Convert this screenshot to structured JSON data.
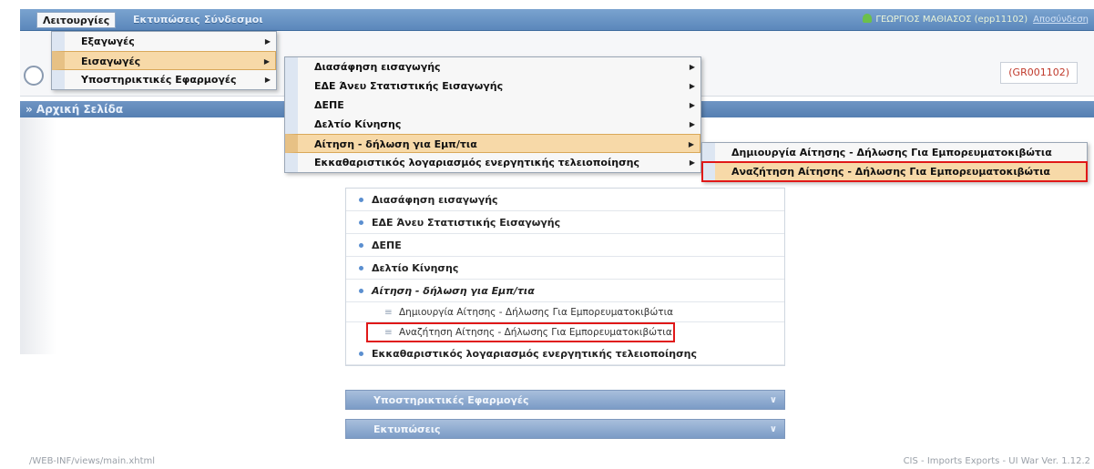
{
  "menubar": {
    "items": [
      "Λειτουργίες",
      "Εκτυπώσεις",
      "Σύνδεσμοι"
    ],
    "user": "ΓΕΩΡΓΙΟΣ ΜΑΘΙΑΣΟΣ (epp11102)",
    "logout": "Αποσύνδεση"
  },
  "header": {
    "office": "(GR001102)"
  },
  "page_title": "» Αρχική Σελίδα",
  "menu_level1": [
    {
      "label": "Εξαγωγές"
    },
    {
      "label": "Εισαγωγές"
    },
    {
      "label": "Υποστηρικτικές Εφαρμογές"
    }
  ],
  "menu_level2": [
    {
      "label": "Διασάφηση εισαγωγής"
    },
    {
      "label": "ΕΔΕ Άνευ Στατιστικής Εισαγωγής"
    },
    {
      "label": "ΔΕΠΕ"
    },
    {
      "label": "Δελτίο Κίνησης"
    },
    {
      "label": "Αίτηση - δήλωση για Εμπ/τια"
    },
    {
      "label": "Εκκαθαριστικός λογαριασμός ενεργητικής τελειοποίησης"
    }
  ],
  "menu_level3": [
    {
      "label": "Δημιουργία Αίτησης - Δήλωσης Για Εμπορευματοκιβώτια"
    },
    {
      "label": "Αναζήτηση Αίτησης - Δήλωσης Για Εμπορευματοκιβώτια"
    }
  ],
  "nav": {
    "items": [
      {
        "label": "Διασάφηση εισαγωγής"
      },
      {
        "label": "ΕΔΕ Άνευ Στατιστικής Εισαγωγής"
      },
      {
        "label": "ΔΕΠΕ"
      },
      {
        "label": "Δελτίο Κίνησης"
      },
      {
        "label": "Αίτηση - δήλωση για Εμπ/τια"
      }
    ],
    "subitems": [
      {
        "label": "Δημιουργία Αίτησης - Δήλωσης Για Εμπορευματοκιβώτια"
      },
      {
        "label": "Αναζήτηση Αίτησης - Δήλωσης Για Εμπορευματοκιβώτια"
      }
    ],
    "last_item": "Εκκαθαριστικός λογαριασμός ενεργητικής τελειοποίησης",
    "accordions": [
      {
        "label": "Υποστηρικτικές Εφαρμογές"
      },
      {
        "label": "Εκτυπώσεις"
      }
    ]
  },
  "footer": {
    "left": "/WEB-INF/views/main.xhtml",
    "right": "CIS - Imports Exports - UI War Ver. 1.12.2"
  },
  "icons": {
    "submenu_arrow": "triangle-right",
    "accordion_chevron": "chevron-down",
    "user": "person-icon"
  }
}
